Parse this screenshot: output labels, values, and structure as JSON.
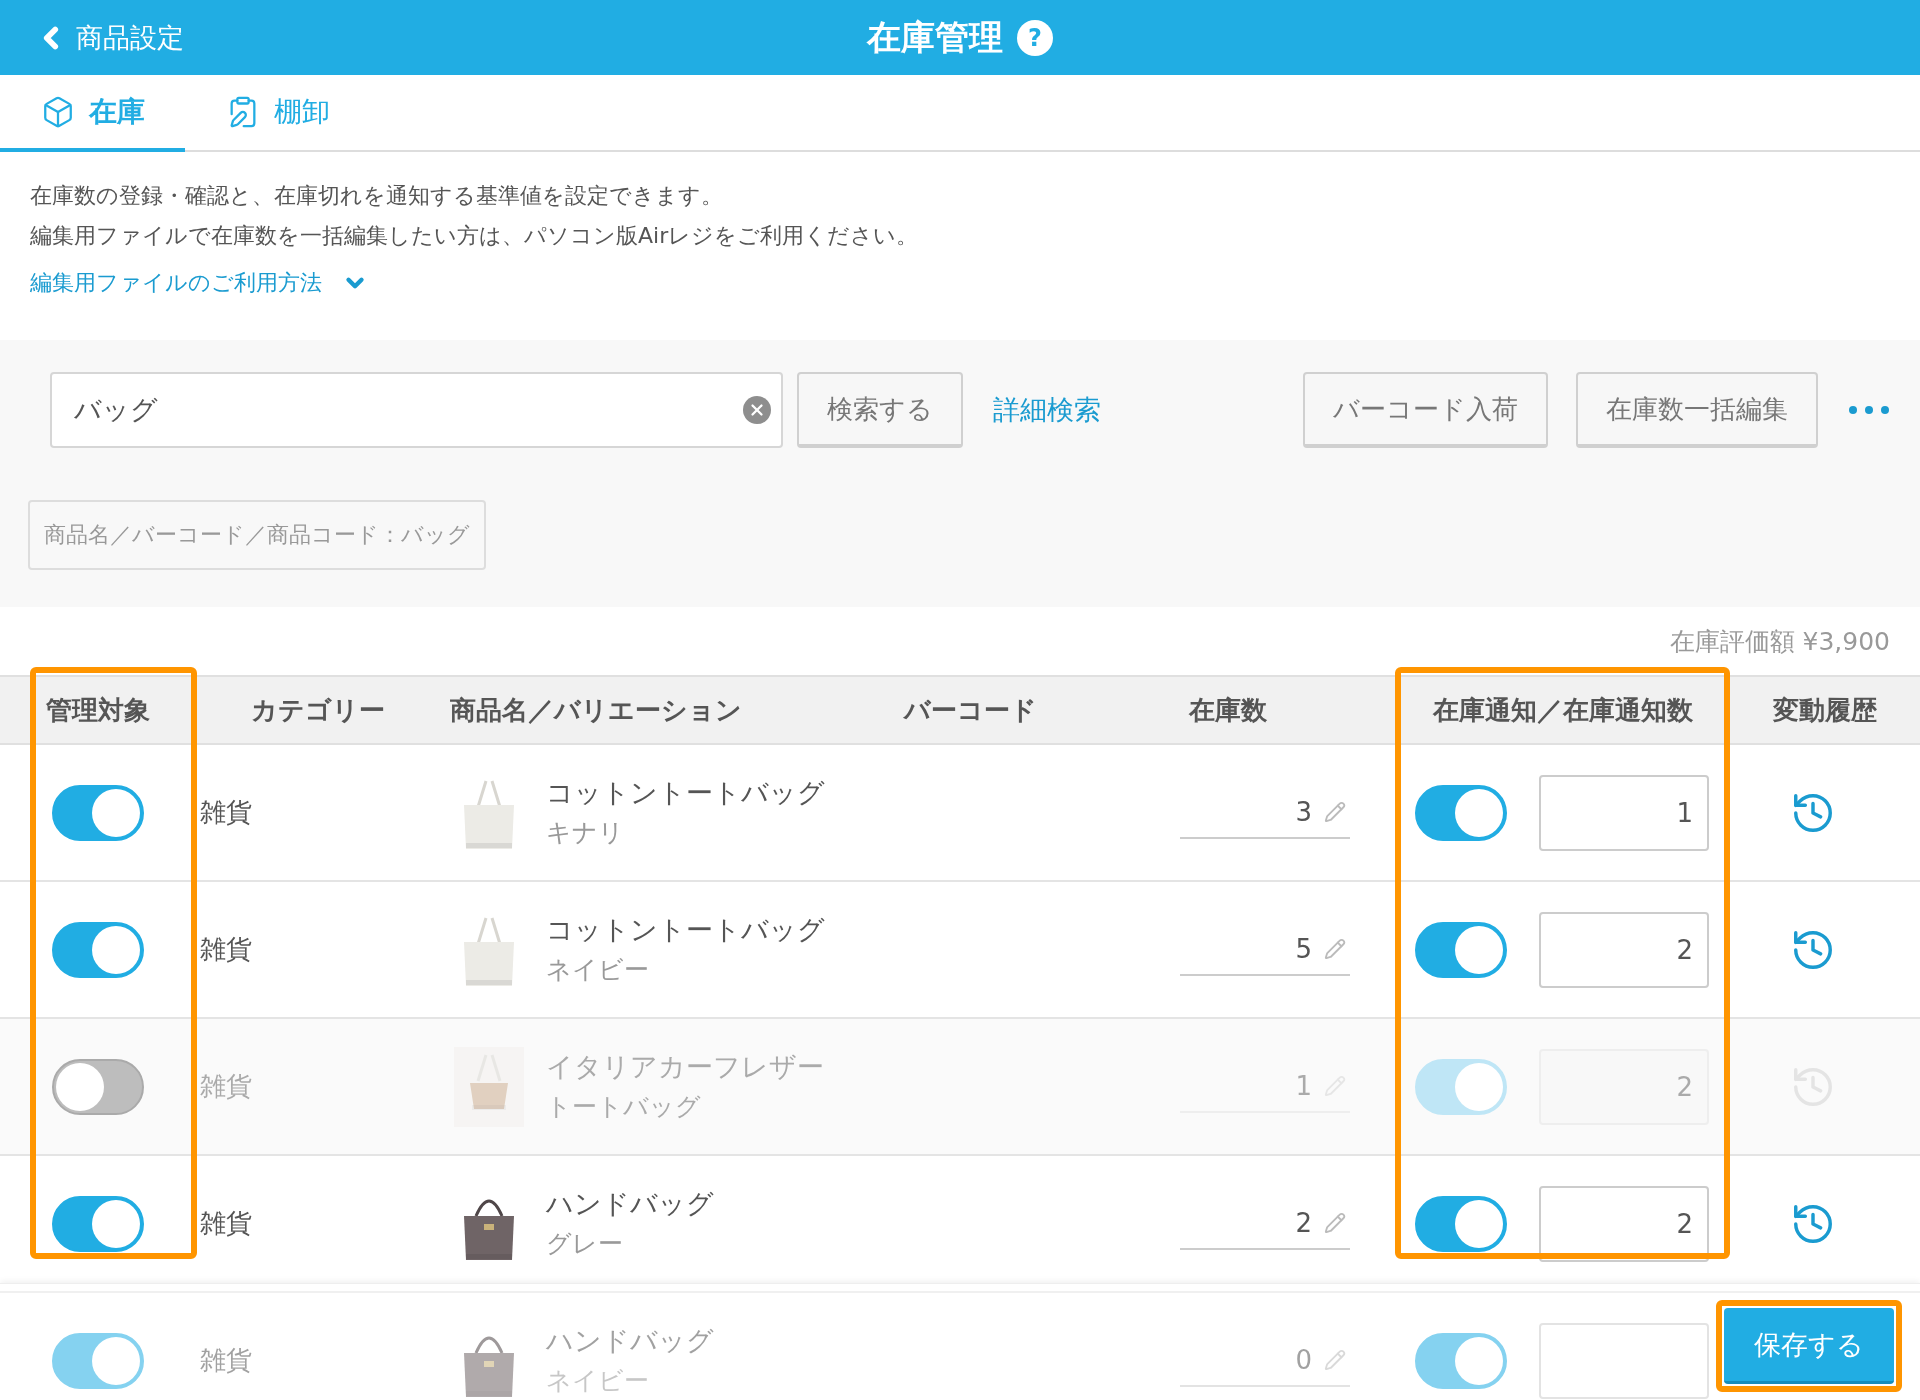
{
  "header": {
    "back_label": "商品設定",
    "title": "在庫管理",
    "help_mark": "?"
  },
  "tabs": [
    {
      "label": "在庫",
      "selected": true
    },
    {
      "label": "棚卸",
      "selected": false
    }
  ],
  "description": [
    "在庫数の登録・確認と、在庫切れを通知する基準値を設定できます。",
    "編集用ファイルで在庫数を一括編集したい方は、パソコン版Airレジをご利用ください。"
  ],
  "help_link": {
    "label": "編集用ファイルのご利用方法",
    "expanded": false
  },
  "search": {
    "value": "バッグ",
    "button": "検索する",
    "advanced_link": "詳細検索",
    "actions": [
      "バーコード入荷",
      "在庫数一括編集"
    ]
  },
  "filter_chip": "商品名／バーコード／商品コード：バッグ",
  "valuation": "在庫評価額 ¥3,900",
  "table": {
    "columns": [
      {
        "label": "管理対象",
        "highlighted": true
      },
      {
        "label": "カテゴリー",
        "highlighted": false
      },
      {
        "label": "商品名／バリエーション",
        "highlighted": false
      },
      {
        "label": "バーコード",
        "highlighted": false
      },
      {
        "label": "在庫数",
        "highlighted": false
      },
      {
        "label": "在庫通知／在庫通知数",
        "highlighted": true
      },
      {
        "label": "変動履歴",
        "highlighted": false
      }
    ],
    "rows": [
      {
        "managed": true,
        "category": "雑貨",
        "name": "コットントートバッグ",
        "variant": "キナリ",
        "stock": "3",
        "notify": true,
        "notify_count": "1"
      },
      {
        "managed": true,
        "category": "雑貨",
        "name": "コットントートバッグ",
        "variant": "ネイビー",
        "stock": "5",
        "notify": true,
        "notify_count": "2"
      },
      {
        "managed": false,
        "category": "雑貨",
        "name": "イタリアカーフレザー",
        "variant": "トートバッグ",
        "stock": "1",
        "notify": true,
        "notify_count": "2"
      },
      {
        "managed": true,
        "category": "雑貨",
        "name": "ハンドバッグ",
        "variant": "グレー",
        "stock": "2",
        "notify": true,
        "notify_count": "2"
      },
      {
        "managed": true,
        "category": "雑貨",
        "name": "ハンドバッグ",
        "variant": "ネイビー",
        "stock": "0",
        "notify": true
      }
    ]
  },
  "save_button": {
    "label": "保存する",
    "highlighted": true
  }
}
